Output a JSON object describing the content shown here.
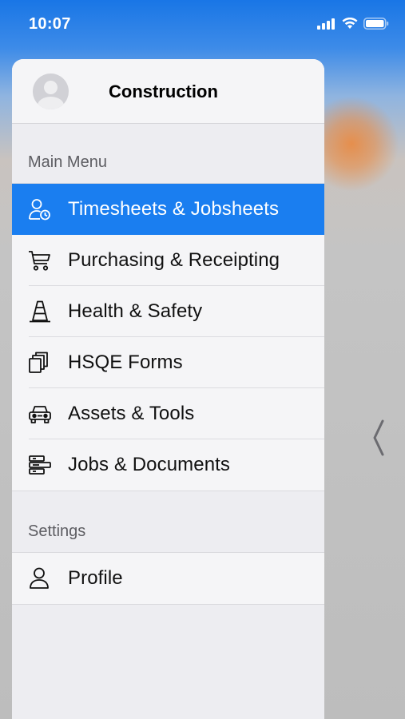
{
  "status_bar": {
    "time": "10:07",
    "icons": [
      "signal-icon",
      "wifi-icon",
      "battery-icon"
    ]
  },
  "drawer": {
    "title": "Construction",
    "main_menu": {
      "label": "Main Menu",
      "items": [
        {
          "label": "Timesheets & Jobsheets",
          "icon": "user-clock-icon",
          "active": true
        },
        {
          "label": "Purchasing & Receipting",
          "icon": "cart-icon",
          "active": false
        },
        {
          "label": "Health & Safety",
          "icon": "traffic-cone-icon",
          "active": false
        },
        {
          "label": "HSQE Forms",
          "icon": "copy-icon",
          "active": false
        },
        {
          "label": "Assets & Tools",
          "icon": "car-icon",
          "active": false
        },
        {
          "label": "Jobs & Documents",
          "icon": "layers-icon",
          "active": false
        }
      ]
    },
    "settings": {
      "label": "Settings",
      "items": [
        {
          "label": "Profile",
          "icon": "user-icon",
          "active": false
        }
      ]
    }
  },
  "colors": {
    "accent": "#1a7ef0",
    "drawer_bg": "#ededf1",
    "item_bg": "#f5f5f7"
  }
}
